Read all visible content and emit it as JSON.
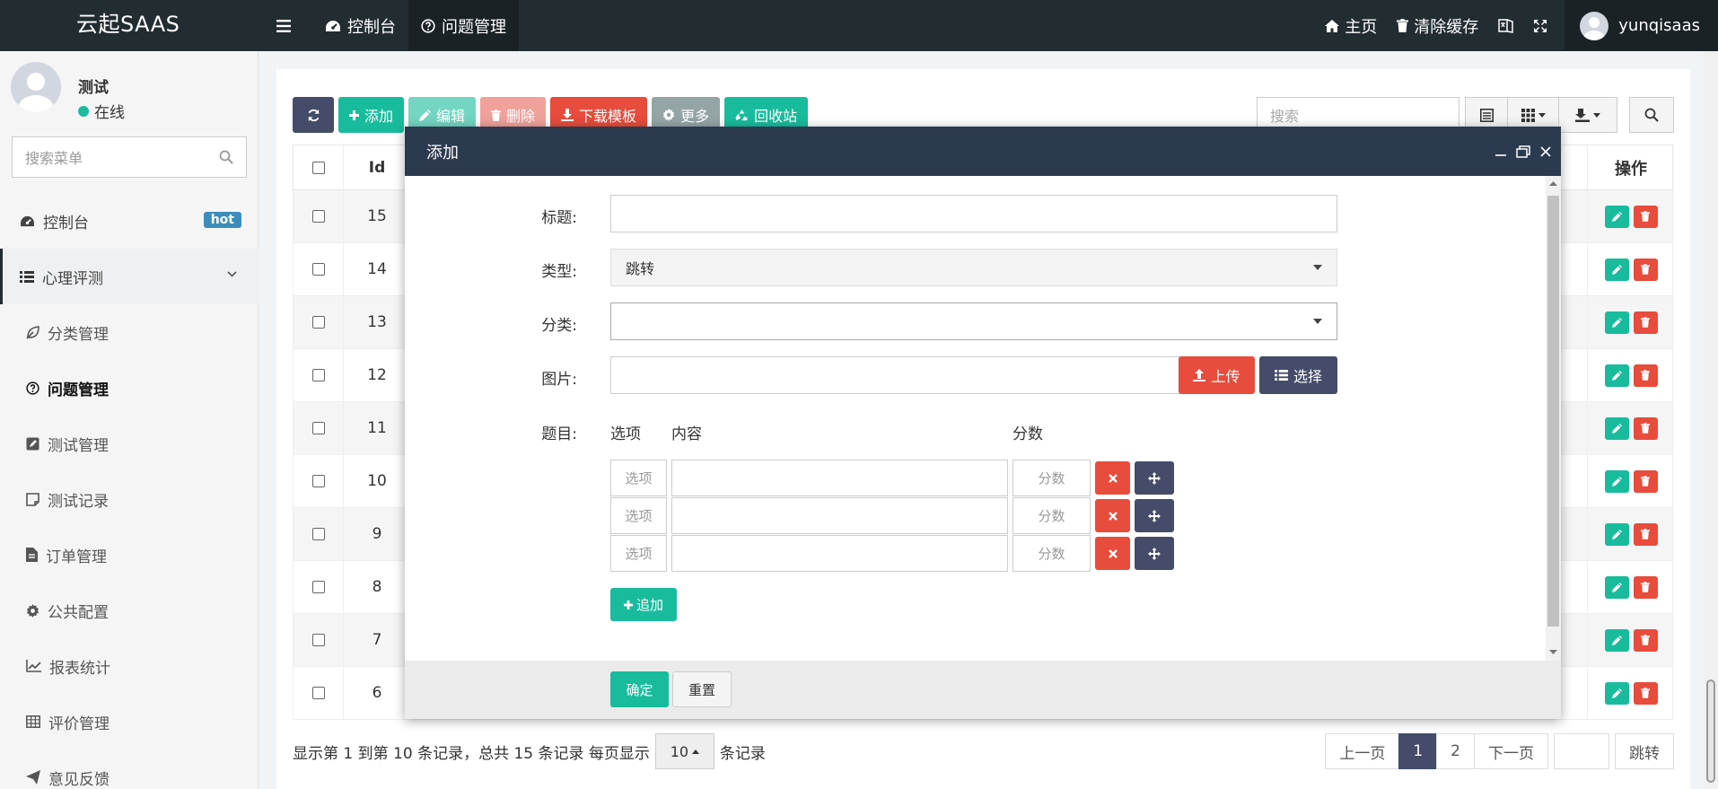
{
  "header": {
    "logo": "云起SAAS",
    "nav": [
      {
        "label": "控制台",
        "icon": "dashboard-icon"
      },
      {
        "label": "问题管理",
        "icon": "question-circle-icon"
      }
    ],
    "right": {
      "home": "主页",
      "clear_cache": "清除缓存",
      "username": "yunqisaas"
    }
  },
  "sidebar": {
    "user_name": "测试",
    "user_status": "在线",
    "search_placeholder": "搜索菜单",
    "items": [
      {
        "label": "控制台",
        "icon": "dashboard-icon",
        "badge": "hot"
      },
      {
        "label": "心理评测",
        "icon": "list-icon"
      },
      {
        "label": "分类管理",
        "icon": "leaf-icon"
      },
      {
        "label": "问题管理",
        "icon": "question-circle-icon"
      },
      {
        "label": "测试管理",
        "icon": "edit-square-icon"
      },
      {
        "label": "测试记录",
        "icon": "note-icon"
      },
      {
        "label": "订单管理",
        "icon": "file-icon"
      },
      {
        "label": "公共配置",
        "icon": "gear-icon"
      },
      {
        "label": "报表统计",
        "icon": "line-chart-icon"
      },
      {
        "label": "评价管理",
        "icon": "table-icon"
      },
      {
        "label": "意见反馈",
        "icon": "send-icon"
      }
    ]
  },
  "toolbar": {
    "add": "添加",
    "edit": "编辑",
    "delete": "删除",
    "download_template": "下载模板",
    "more": "更多",
    "recycle": "回收站",
    "search_placeholder": "搜索"
  },
  "table": {
    "col_id": "Id",
    "col_actions": "操作",
    "rows": [
      "15",
      "14",
      "13",
      "12",
      "11",
      "10",
      "9",
      "8",
      "7",
      "6"
    ]
  },
  "footer": {
    "summary": "显示第 1 到第 10 条记录，总共 15 条记录 每页显示",
    "page_size": "10",
    "suffix": "条记录",
    "prev": "上一页",
    "pages": [
      "1",
      "2"
    ],
    "next": "下一页",
    "jump": "跳转"
  },
  "modal": {
    "title": "添加",
    "labels": {
      "title": "标题:",
      "type": "类型:",
      "category": "分类:",
      "image": "图片:",
      "question": "题目:"
    },
    "values": {
      "title": "",
      "type": "跳转",
      "category": "",
      "image": ""
    },
    "buttons": {
      "upload": "上传",
      "choose": "选择",
      "append": "追加",
      "confirm": "确定",
      "reset": "重置"
    },
    "question_headers": {
      "option": "选项",
      "content": "内容",
      "score": "分数"
    },
    "option_placeholder": "选项",
    "score_placeholder": "分数",
    "option_rows": [
      {
        "option": "",
        "content": "",
        "score": ""
      },
      {
        "option": "",
        "content": "",
        "score": ""
      },
      {
        "option": "",
        "content": "",
        "score": ""
      }
    ]
  }
}
